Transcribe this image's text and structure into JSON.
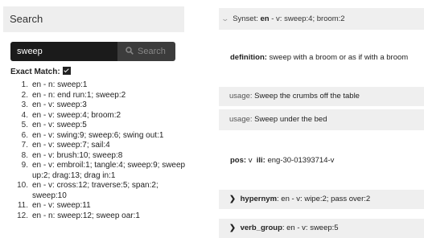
{
  "left": {
    "header": "Search",
    "search": {
      "value": "sweep",
      "button_label": "Search"
    },
    "exact_match_label": "Exact Match:",
    "exact_match_checked": true,
    "results": [
      {
        "num": "1.",
        "text": "en - n: sweep:1"
      },
      {
        "num": "2.",
        "text": "en - n: end run:1; sweep:2"
      },
      {
        "num": "3.",
        "text": "en - v: sweep:3"
      },
      {
        "num": "4.",
        "text": "en - v: sweep:4; broom:2"
      },
      {
        "num": "5.",
        "text": "en - v: sweep:5"
      },
      {
        "num": "6.",
        "text": "en - v: swing:9; sweep:6; swing out:1"
      },
      {
        "num": "7.",
        "text": "en - v: sweep:7; sail:4"
      },
      {
        "num": "8.",
        "text": "en - v: brush:10; sweep:8"
      },
      {
        "num": "9.",
        "text": "en - v: embroil:1; tangle:4; sweep:9; sweep up:2; drag:13; drag in:1"
      },
      {
        "num": "10.",
        "text": "en - v: cross:12; traverse:5; span:2; sweep:10"
      },
      {
        "num": "11.",
        "text": "en - v: sweep:11"
      },
      {
        "num": "12.",
        "text": "en - n: sweep:12; sweep oar:1"
      }
    ]
  },
  "right": {
    "synset": {
      "label": "Synset:",
      "value": "en - v: sweep:4; broom:2"
    },
    "definition": {
      "label": "definition:",
      "value": "sweep with a broom or as if with a broom"
    },
    "usages": [
      {
        "label": "usage:",
        "value": "Sweep the crumbs off the table"
      },
      {
        "label": "usage:",
        "value": "Sweep under the bed"
      }
    ],
    "pos": {
      "label": "pos:",
      "value": "v"
    },
    "ili": {
      "label": "ili:",
      "value": "eng-30-01393714-v"
    },
    "hypernym": {
      "label": "hypernym",
      "value": ": en - v: wipe:2; pass over:2"
    },
    "verb_group": {
      "label": "verb_group",
      "value": ": en - v: sweep:5"
    }
  }
}
